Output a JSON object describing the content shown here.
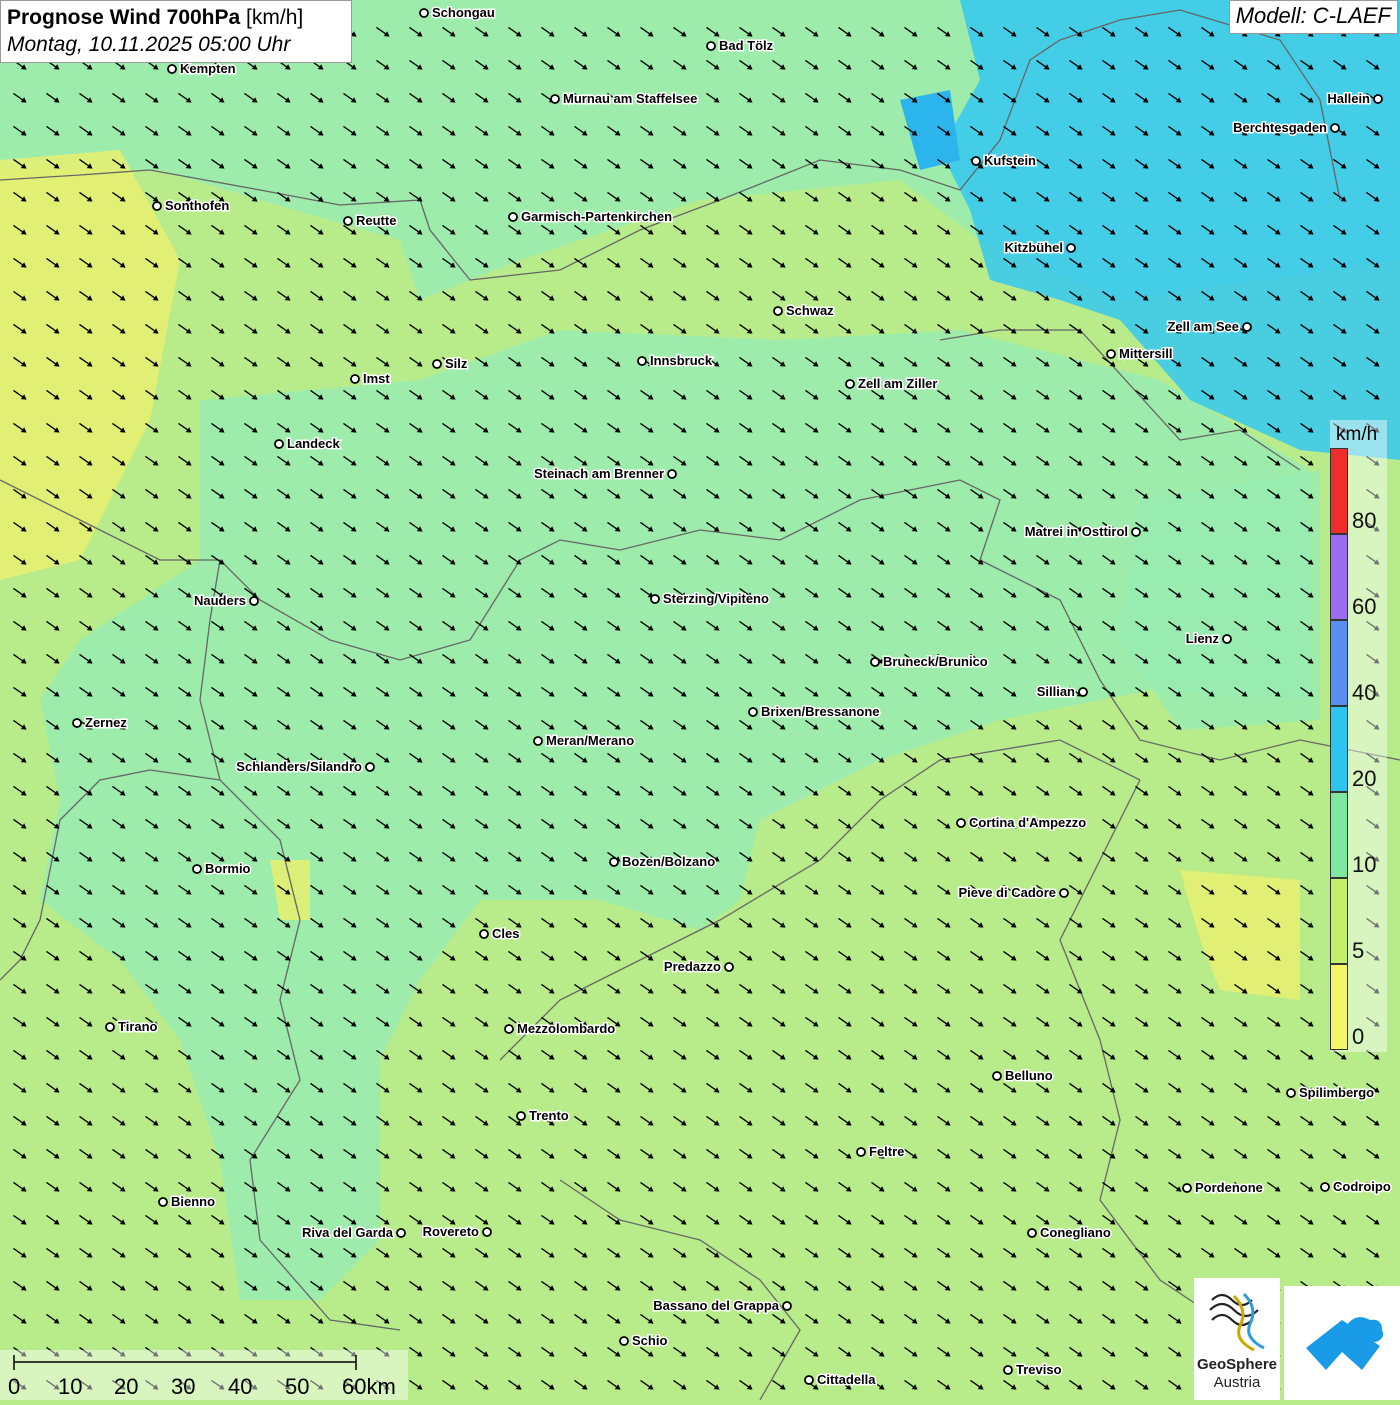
{
  "header": {
    "title_bold": "Prognose Wind 700hPa",
    "title_unit": "[km/h]",
    "datetime": "Montag, 10.11.2025 05:00 Uhr"
  },
  "model": {
    "label": "Modell: C-LAEF"
  },
  "legend": {
    "unit": "km/h",
    "levels": [
      {
        "label": "80",
        "color": "#f02d2d"
      },
      {
        "label": "60",
        "color": "#9b6ef0"
      },
      {
        "label": "40",
        "color": "#5a8ef0"
      },
      {
        "label": "20",
        "color": "#2ec4f0"
      },
      {
        "label": "10",
        "color": "#7ee8a0"
      },
      {
        "label": "5",
        "color": "#c2f06a"
      },
      {
        "label": "0",
        "color": "#f5f56a"
      }
    ],
    "top_color": "#f02d2d"
  },
  "colors": {
    "calm_0_5": "#e8f070",
    "light_5_10": "#b8ec8a",
    "moderate_10_20": "#98ecb0",
    "strong_20_40": "#34c8f0",
    "strong_dark": "#2cb4ec",
    "border": "#666666",
    "arrow": "#000000"
  },
  "wind_direction": "from north-west",
  "cities": [
    {
      "name": "Schongau"
    },
    {
      "name": "Bad Tölz"
    },
    {
      "name": "Kempten"
    },
    {
      "name": "Murnau am Staffelsee"
    },
    {
      "name": "Hallein"
    },
    {
      "name": "Berchtesgaden"
    },
    {
      "name": "Kufstein"
    },
    {
      "name": "Sonthofen"
    },
    {
      "name": "Reutte"
    },
    {
      "name": "Garmisch-Partenkirchen"
    },
    {
      "name": "Kitzbühel"
    },
    {
      "name": "Schwaz"
    },
    {
      "name": "Zell am See"
    },
    {
      "name": "Mittersill"
    },
    {
      "name": "Silz"
    },
    {
      "name": "Innsbruck"
    },
    {
      "name": "Imst"
    },
    {
      "name": "Zell am Ziller"
    },
    {
      "name": "Landeck"
    },
    {
      "name": "Steinach am Brenner"
    },
    {
      "name": "Matrei in Osttirol"
    },
    {
      "name": "Nauders"
    },
    {
      "name": "Sterzing/Vipiteno"
    },
    {
      "name": "Lienz"
    },
    {
      "name": "Bruneck/Brunico"
    },
    {
      "name": "Sillian"
    },
    {
      "name": "Brixen/Bressanone"
    },
    {
      "name": "Zernez"
    },
    {
      "name": "Meran/Merano"
    },
    {
      "name": "Schlanders/Silandro"
    },
    {
      "name": "Cortina d'Ampezzo"
    },
    {
      "name": "Bozen/Bolzano"
    },
    {
      "name": "Bormio"
    },
    {
      "name": "Pieve di Cadore"
    },
    {
      "name": "Cles"
    },
    {
      "name": "Predazzo"
    },
    {
      "name": "Tirano"
    },
    {
      "name": "Mezzolombardo"
    },
    {
      "name": "Belluno"
    },
    {
      "name": "Spilimbergo"
    },
    {
      "name": "Trento"
    },
    {
      "name": "Feltre"
    },
    {
      "name": "Pordenone"
    },
    {
      "name": "Codroipo"
    },
    {
      "name": "Bienno"
    },
    {
      "name": "Riva del Garda"
    },
    {
      "name": "Rovereto"
    },
    {
      "name": "Conegliano"
    },
    {
      "name": "Bassano del Grappa"
    },
    {
      "name": "Schio"
    },
    {
      "name": "Treviso"
    },
    {
      "name": "Cittadella"
    }
  ],
  "scalebar": {
    "ticks": [
      "0",
      "10",
      "20",
      "30",
      "40",
      "50",
      "60km"
    ]
  },
  "logo": {
    "name1": "GeoSphere",
    "name2": "Austria"
  }
}
